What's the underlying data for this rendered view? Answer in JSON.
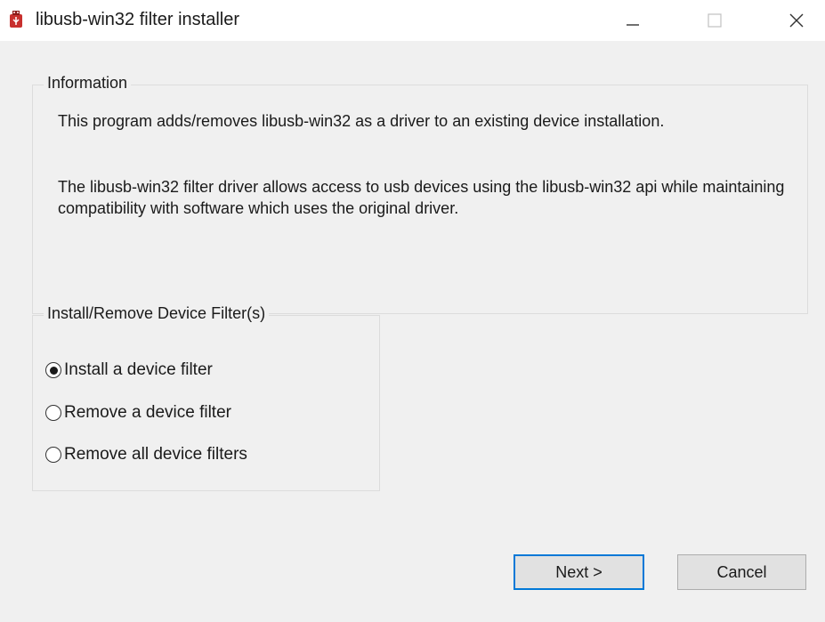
{
  "window": {
    "title": "libusb-win32 filter installer",
    "icon": "usb-plug-icon",
    "controls": [
      "minimize-icon",
      "maximize-icon",
      "close-icon"
    ]
  },
  "information": {
    "legend": "Information",
    "paragraph1": "This program adds/removes libusb-win32 as a driver to an existing device installation.",
    "paragraph2": "The libusb-win32 filter driver allows access to usb devices using the libusb-win32 api while maintaining compatibility with software which uses the original driver."
  },
  "filter_group": {
    "legend": "Install/Remove Device Filter(s)",
    "options": [
      {
        "label": "Install a device filter",
        "selected": true
      },
      {
        "label": "Remove a device filter",
        "selected": false
      },
      {
        "label": "Remove all device filters",
        "selected": false
      }
    ]
  },
  "buttons": {
    "next": "Next >",
    "cancel": "Cancel"
  },
  "colors": {
    "default_button_border": "#0078d7",
    "dialog_background": "#f0f0f0",
    "titlebar_background": "#ffffff"
  }
}
